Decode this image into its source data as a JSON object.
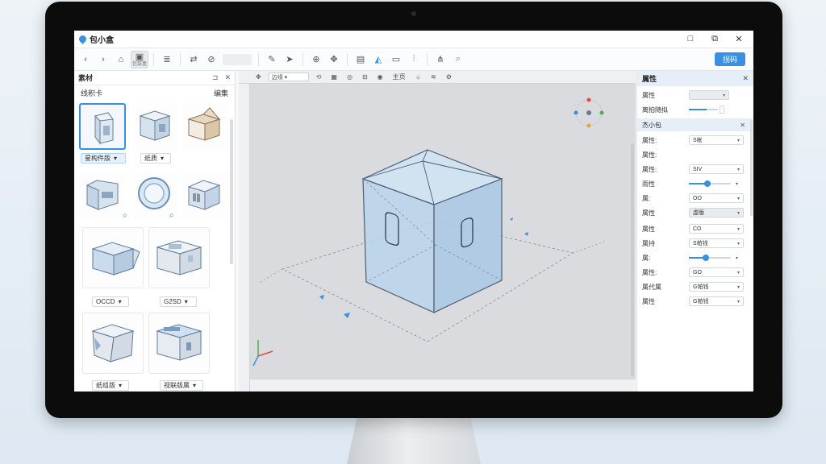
{
  "window": {
    "title": "包小盒",
    "controls": [
      "□",
      "⧉",
      "✕"
    ]
  },
  "toolbar": {
    "active_tool_sub": "包装盒",
    "primary_label": "拐码",
    "icons": [
      "chevron-left-icon",
      "chevron-right-icon",
      "home-icon",
      "layout-icon",
      "stack-icon",
      "arrows-icon",
      "link-icon",
      "pen-icon",
      "cursor-icon",
      "globe-icon",
      "move-icon",
      "doc-icon",
      "person-icon",
      "folder-icon",
      "chart-icon",
      "search-icon"
    ]
  },
  "left_panel": {
    "title": "素材",
    "subtitle_left": "线积卡",
    "subtitle_right": "编集",
    "header_ctrls": [
      "⊐",
      "✕"
    ],
    "dropdowns": [
      {
        "label": "星构件版",
        "highlight": true
      },
      {
        "label": "纸质",
        "highlight": false
      },
      {
        "label": "OCCD",
        "highlight": false
      },
      {
        "label": "G2SD",
        "highlight": false
      },
      {
        "label": "纸组版",
        "highlight": false
      },
      {
        "label": "视联版属",
        "highlight": false
      }
    ]
  },
  "viewport": {
    "ruler_items": [
      "边缘",
      "主页"
    ]
  },
  "right_panel": {
    "title": "属性",
    "section_title": "杰小包",
    "rows_top": [
      {
        "label": "属性",
        "value": "",
        "kind": "select-grey"
      },
      {
        "label": "离拍随拟",
        "value": "",
        "kind": "slider",
        "level": 0.6
      }
    ],
    "rows": [
      {
        "label": "属性:",
        "value": "S帐",
        "kind": "select"
      },
      {
        "label": "属性:",
        "value": "",
        "kind": "none"
      },
      {
        "label": "属性:",
        "value": "SIV",
        "kind": "select"
      },
      {
        "label": "雨性",
        "value": "",
        "kind": "slider",
        "level": 0.45
      },
      {
        "label": "属:",
        "value": "OO",
        "kind": "select"
      },
      {
        "label": "属性",
        "value": "虚版",
        "kind": "select-grey"
      },
      {
        "label": "属性",
        "value": "CO",
        "kind": "select"
      },
      {
        "label": "属持",
        "value": "S帕钱",
        "kind": "select"
      },
      {
        "label": "属:",
        "value": "",
        "kind": "slider",
        "level": 0.4
      },
      {
        "label": "属性:",
        "value": "GO",
        "kind": "select"
      },
      {
        "label": "属代属",
        "value": "G帕钱",
        "kind": "select"
      },
      {
        "label": "属性",
        "value": "G帕钱",
        "kind": "select"
      }
    ],
    "colors": {
      "accent": "#3b8fe0",
      "section_bg": "#e6eef7"
    }
  }
}
